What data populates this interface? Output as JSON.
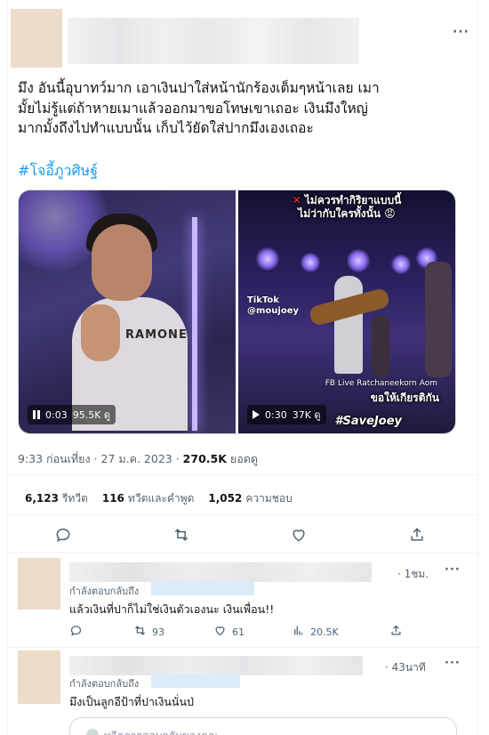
{
  "tweet": {
    "more_label": "···",
    "text_line1": "มึง อันนี้อุบาทว์มาก เอาเงินปาใส่หน้านักร้องเต็มๆหน้าเลย เมา",
    "text_line2": "มั้ยไม่รู้แต่ถ้าหายเมาแล้วออกมาขอโทษเขาเถอะ เงินมึงใหญ่",
    "text_line3": "มากมั้งถึงไปทำแบบนั้น เก็บไว้ยัดใส่ปากมึงเองเถอะ",
    "hashtag": "#โจอี้ภูวศิษฐ์",
    "media": {
      "left": {
        "time": "0:03",
        "views": "95.5K ดู",
        "shirt_text": "RAMONE"
      },
      "right": {
        "caption_x": "✕",
        "caption_line1": "ไม่ควรทำกิริยาแบบนี้",
        "caption_line2": "ไม่ว่ากับใครทั้งนั้น 😡",
        "tiktok_line1": "TikTok",
        "tiktok_line2": "@moujoey",
        "fb_live": "FB Live Ratchaneekorn Aom",
        "bottom_caption": "ขอให้เกียรติกัน",
        "save_tag": "#SaveJoey",
        "time": "0:30",
        "views": "37K ดู"
      }
    },
    "time": "9:33 ก่อนเที่ยง",
    "dot": " · ",
    "date": "27 ม.ค. 2023",
    "views_count": "270.5K",
    "views_label": "ยอดดู",
    "retweets": "6,123",
    "retweets_label": "รีทวีต",
    "quotes": "116",
    "quotes_label": "ทวีตและคำพูด",
    "likes": "1,052",
    "likes_label": "ความชอบ"
  },
  "replies": [
    {
      "time": "· 1ชม.",
      "more": "···",
      "replying_label": "กำลังตอบกลับถึง",
      "text": "แล้วเงินที่ปาก็ไม่ใช่เงินตัวเองนะ เงินเพื่อน!!",
      "retweets": "93",
      "likes": "61",
      "views": "20.5K"
    },
    {
      "time": "· 43นาที",
      "more": "···",
      "replying_label": "กำลังตอบกลับถึง",
      "text": "มึงเป็นลูกอีป้าที่ปาเงินนั่นป่"
    }
  ],
  "compose": {
    "hint": "ทวีตการตอบกลับของคุณ"
  },
  "colors": {
    "accent": "#1d9bf0",
    "text": "#0f1419",
    "muted": "#536471"
  }
}
